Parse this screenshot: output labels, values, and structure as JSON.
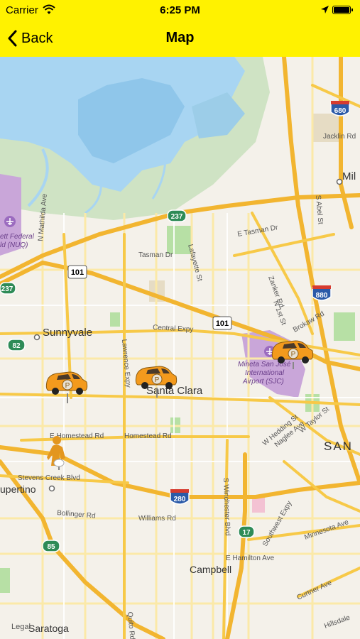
{
  "status": {
    "carrier": "Carrier",
    "time": "6:25 PM"
  },
  "nav": {
    "back_label": "Back",
    "title": "Map"
  },
  "map": {
    "cities": {
      "sunnyvale": "Sunnyvale",
      "santa_clara": "Santa Clara",
      "campbell": "Campbell",
      "cupertino": "upertino",
      "saratoga": "Saratoga",
      "san": "SAN",
      "milpitas": "Mil"
    },
    "streets": {
      "tasman_dr": "Tasman Dr",
      "e_tasman_dr": "E Tasman Dr",
      "lafayette_st": "Lafayette St",
      "central_expy": "Central Expy",
      "lawrence_expy": "Lawrence Expy",
      "homestead_rd": "Homestead Rd",
      "e_homestead_rd": "E Homestead Rd",
      "stevens_creek_blvd": "Stevens Creek Blvd",
      "bollinger_rd": "Bollinger Rd",
      "williams_rd": "Williams Rd",
      "winchester_blvd": "S Winchester Blvd",
      "e_hamilton_ave": "E Hamilton Ave",
      "southwest_expy": "Southwest Expy",
      "minnesota_ave": "Minnesota Ave",
      "curtner_ave": "Curtner Ave",
      "hillsdale": "Hillsdale",
      "quito_rd": "Quito Rd",
      "zanker_rd": "Zanker Rd",
      "n_1st_st": "N 1st St",
      "brokaw_rd": "Brokaw Rd",
      "jacklin_rd": "Jacklin Rd",
      "s_abel_st": "S Abel St",
      "w_hedding_st": "W Hedding St",
      "naglee_ave": "Naglee Ave",
      "w_taylor_st": "W Taylor St",
      "n_mathilda_ave": "N Mathilda Ave"
    },
    "airport": [
      "Mineta San José",
      "International",
      "Airport (SJC)"
    ],
    "airfield": [
      "ett Federal",
      "ld (NUQ)"
    ],
    "shields": {
      "i680": "680",
      "i880": "880",
      "i280": "280",
      "us101_a": "101",
      "us101_b": "101",
      "r237_a": "237",
      "r237_b": "237",
      "r82": "82",
      "r85": "85",
      "r17": "17"
    },
    "legal": "Legal"
  },
  "colors": {
    "bar": "#fff200",
    "water": "#a8d5f2",
    "road": "#f7c948",
    "park": "#b7e0a5",
    "land": "#f4f1ea"
  }
}
